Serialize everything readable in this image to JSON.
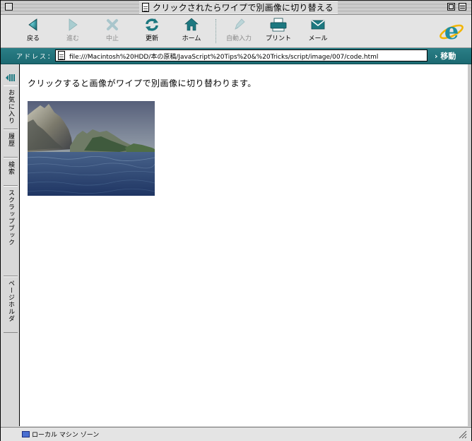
{
  "window": {
    "title": "クリックされたらワイプで別画像に切り替える"
  },
  "toolbar": {
    "buttons": [
      {
        "id": "back",
        "label": "戻る",
        "enabled": true,
        "icon": "arrow-left-icon"
      },
      {
        "id": "forward",
        "label": "進む",
        "enabled": false,
        "icon": "arrow-right-icon"
      },
      {
        "id": "stop",
        "label": "中止",
        "enabled": false,
        "icon": "close-icon"
      },
      {
        "id": "refresh",
        "label": "更新",
        "enabled": true,
        "icon": "refresh-icon"
      },
      {
        "id": "home",
        "label": "ホーム",
        "enabled": true,
        "icon": "home-icon"
      },
      {
        "id": "autofill",
        "label": "自動入力",
        "enabled": false,
        "icon": "pencil-icon"
      },
      {
        "id": "print",
        "label": "プリント",
        "enabled": true,
        "icon": "printer-icon"
      },
      {
        "id": "mail",
        "label": "メール",
        "enabled": true,
        "icon": "mail-icon"
      }
    ],
    "accent_color": "#1f7f88"
  },
  "address_bar": {
    "label": "アドレス：",
    "url": "file:///Macintosh%20HDD/本の原稿/JavaScript%20Tips%20&%20Tricks/script/image/007/code.html",
    "go_label": "移動"
  },
  "explorer_bar": {
    "tabs": [
      "お気に入り",
      "履歴",
      "検索",
      "スクラップブック",
      "ページホルダ"
    ]
  },
  "content": {
    "text": "クリックすると画像がワイプで別画像に切り替わります。",
    "image": "landscape-photo"
  },
  "status_bar": {
    "zone_text": "ローカル マシン ゾーン"
  }
}
